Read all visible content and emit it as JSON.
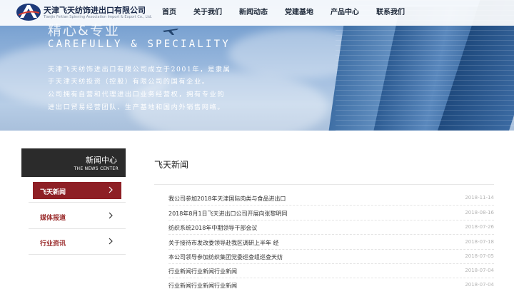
{
  "header": {
    "logo_cn": "天津飞天纺饰进出口有限公司",
    "logo_en": "Tianjin Feitian Spinning Association Import & Export Co., Ltd.",
    "nav": [
      "首页",
      "关于我们",
      "新闻动态",
      "党建基地",
      "产品中心",
      "联系我们"
    ]
  },
  "hero": {
    "title": "精心&专业",
    "subtitle": "CAREFULLY & SPECIALITY",
    "lines": [
      "天津飞天纺饰进出口有限公司成立于2001年，是隶属",
      "于天津天纺投资（控股）有限公司的国有企业。",
      "公司拥有自营和代理进出口业务经营权，拥有专业的",
      "进出口贸易经营团队、生产基地和国内外销售网络。"
    ]
  },
  "sidebar": {
    "title_cn": "新闻中心",
    "title_en": "THE NEWS CENTER",
    "items": [
      {
        "label": "飞天新闻",
        "active": true
      },
      {
        "label": "媒体报道",
        "active": false
      },
      {
        "label": "行业资讯",
        "active": false
      }
    ]
  },
  "main": {
    "title": "飞天新闻",
    "news": [
      {
        "title": "我公司参加2018年天津国际肉类与食品进出口",
        "date": "2018-11-14"
      },
      {
        "title": "2018年8月1日飞天进出口公司开展向张黎明同",
        "date": "2018-08-16"
      },
      {
        "title": "纺织系统2018年中期领导干部会议",
        "date": "2018-07-26"
      },
      {
        "title": "关于接待市发改委领导赴我区调研上半年 经",
        "date": "2018-07-18"
      },
      {
        "title": "本公司领导参加纺织集团党委巡查组巡查天纺",
        "date": "2018-07-05"
      },
      {
        "title": "行业新闻行业新闻行业新闻",
        "date": "2018-07-04"
      },
      {
        "title": "行业新闻行业新闻行业新闻",
        "date": "2018-07-04"
      }
    ]
  },
  "colors": {
    "accent": "#8e1f25",
    "side_head_bg": "#2b2b2b"
  }
}
